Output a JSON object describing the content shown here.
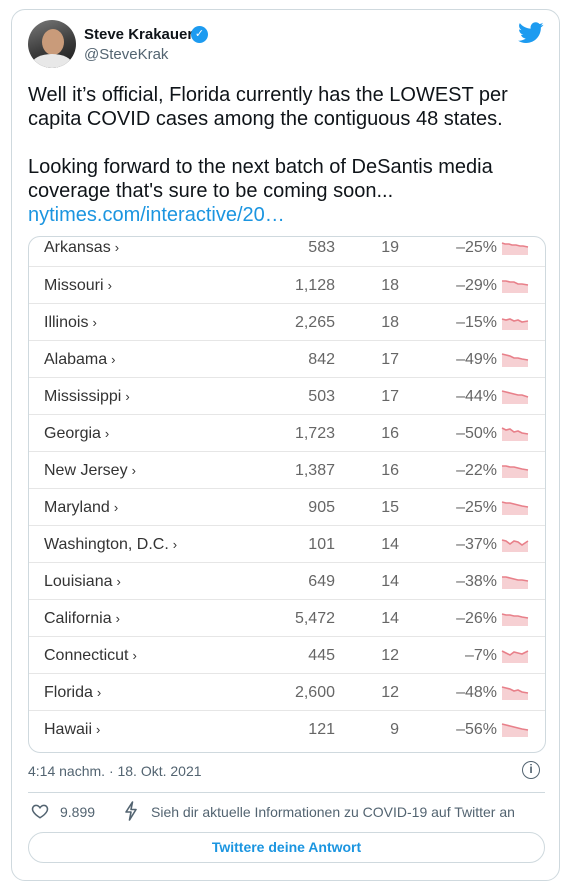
{
  "author": {
    "name": "Steve Krakauer",
    "handle": "@SteveKrak"
  },
  "tweet": {
    "line1": "Well it’s official, Florida currently has the LOWEST per capita COVID cases among the contiguous 48 states.",
    "line2": "Looking forward to the next batch of DeSantis media coverage that's sure to be coming soon...",
    "link": "nytimes.com/interactive/20…"
  },
  "table": {
    "arrow": "›",
    "rows": [
      {
        "state": "Arkansas",
        "cases": "583",
        "per100k": "19",
        "change": "–25%"
      },
      {
        "state": "Missouri",
        "cases": "1,128",
        "per100k": "18",
        "change": "–29%"
      },
      {
        "state": "Illinois",
        "cases": "2,265",
        "per100k": "18",
        "change": "–15%"
      },
      {
        "state": "Alabama",
        "cases": "842",
        "per100k": "17",
        "change": "–49%"
      },
      {
        "state": "Mississippi",
        "cases": "503",
        "per100k": "17",
        "change": "–44%"
      },
      {
        "state": "Georgia",
        "cases": "1,723",
        "per100k": "16",
        "change": "–50%"
      },
      {
        "state": "New Jersey",
        "cases": "1,387",
        "per100k": "16",
        "change": "–22%"
      },
      {
        "state": "Maryland",
        "cases": "905",
        "per100k": "15",
        "change": "–25%"
      },
      {
        "state": "Washington, D.C.",
        "cases": "101",
        "per100k": "14",
        "change": "–37%"
      },
      {
        "state": "Louisiana",
        "cases": "649",
        "per100k": "14",
        "change": "–38%"
      },
      {
        "state": "California",
        "cases": "5,472",
        "per100k": "14",
        "change": "–26%"
      },
      {
        "state": "Connecticut",
        "cases": "445",
        "per100k": "12",
        "change": "–7%"
      },
      {
        "state": "Florida",
        "cases": "2,600",
        "per100k": "12",
        "change": "–48%"
      },
      {
        "state": "Hawaii",
        "cases": "121",
        "per100k": "9",
        "change": "–56%"
      }
    ],
    "sparkline_color": "#e8808a"
  },
  "footer": {
    "timestamp": "4:14 nachm. · 18. Okt. 2021",
    "likes": "9.899",
    "covid_info": "Sieh dir aktuelle Informationen zu COVID-19 auf Twitter an",
    "reply_button": "Twittere deine Antwort"
  },
  "icons": {
    "verified": "verified-badge-icon",
    "logo": "twitter-bird-icon",
    "info": "info-icon",
    "like": "heart-icon",
    "bolt": "lightning-icon"
  },
  "colors": {
    "accent": "#1d9bf0",
    "link": "#1b95e0",
    "muted": "#536471"
  }
}
